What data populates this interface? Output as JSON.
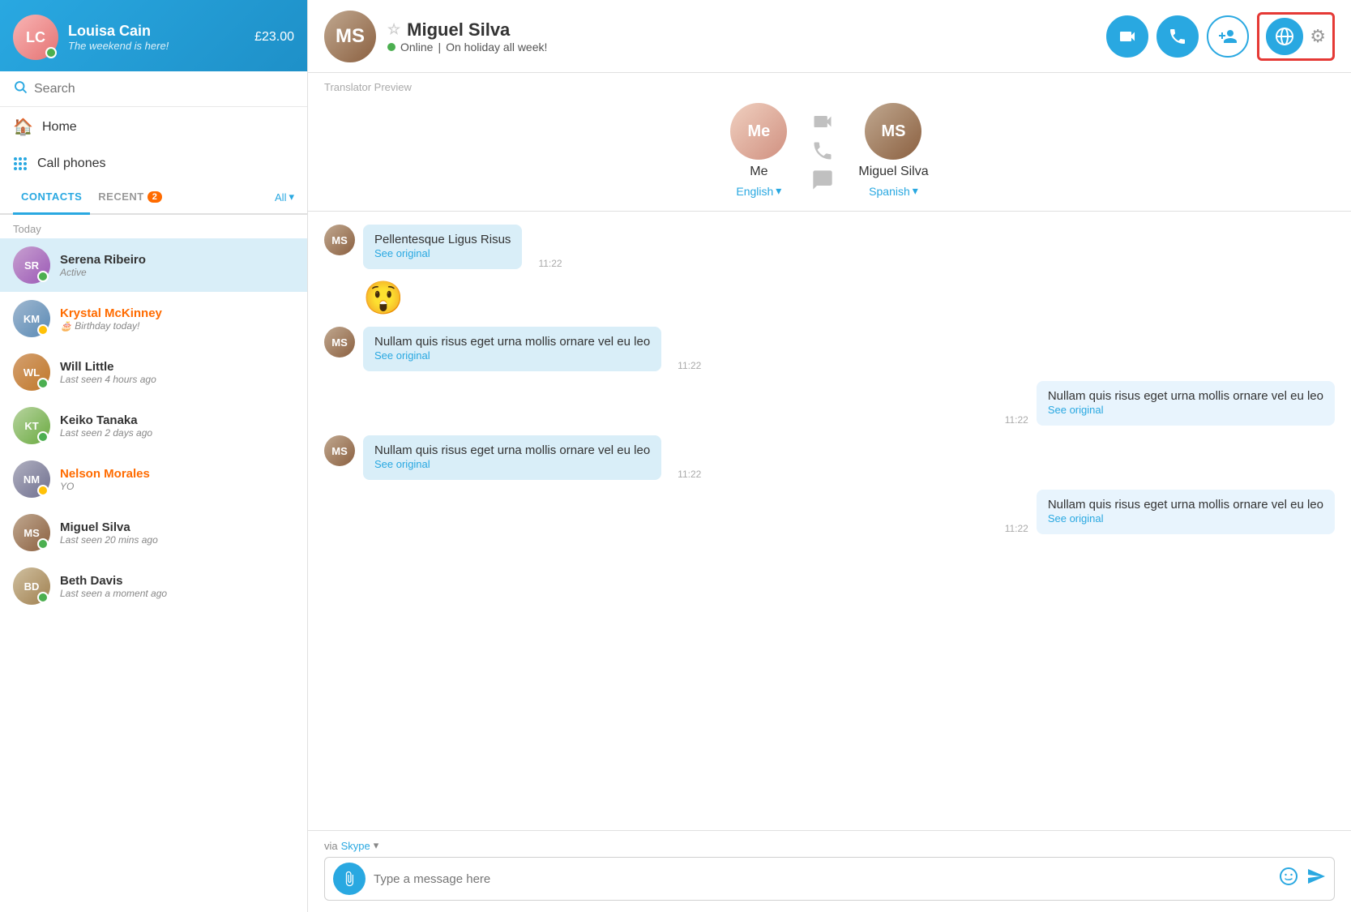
{
  "sidebar": {
    "user": {
      "name": "Louisa Cain",
      "status": "The weekend is here!",
      "credit": "£23.00",
      "initials": "LC"
    },
    "search": {
      "placeholder": "Search"
    },
    "nav": [
      {
        "id": "home",
        "label": "Home",
        "icon": "🏠"
      },
      {
        "id": "callphones",
        "label": "Call phones",
        "icon": "⠿"
      }
    ],
    "tabs": [
      {
        "id": "contacts",
        "label": "CONTACTS",
        "active": true,
        "badge": null
      },
      {
        "id": "recent",
        "label": "RECENT",
        "active": false,
        "badge": "2"
      }
    ],
    "all_label": "All",
    "section_today": "Today",
    "contacts": [
      {
        "id": "serena",
        "name": "Serena Ribeiro",
        "sub": "Active",
        "status": "online",
        "selected": true,
        "initials": "SR",
        "color": "av-serena",
        "nameColor": ""
      },
      {
        "id": "krystal",
        "name": "Krystal McKinney",
        "sub": "🎂 Birthday today!",
        "status": "away",
        "selected": false,
        "initials": "KM",
        "color": "av-krystal",
        "nameColor": "orange"
      },
      {
        "id": "will",
        "name": "Will Little",
        "sub": "Last seen 4 hours ago",
        "status": "online",
        "selected": false,
        "initials": "WL",
        "color": "av-will",
        "nameColor": ""
      },
      {
        "id": "keiko",
        "name": "Keiko Tanaka",
        "sub": "Last seen 2 days ago",
        "status": "online",
        "selected": false,
        "initials": "KT",
        "color": "av-keiko",
        "nameColor": ""
      },
      {
        "id": "nelson",
        "name": "Nelson Morales",
        "sub": "YO",
        "status": "away",
        "selected": false,
        "initials": "NM",
        "color": "av-nelson",
        "nameColor": "orange"
      },
      {
        "id": "miguel",
        "name": "Miguel Silva",
        "sub": "Last seen 20 mins ago",
        "status": "online",
        "selected": false,
        "initials": "MS",
        "color": "av-miguel",
        "nameColor": ""
      },
      {
        "id": "beth",
        "name": "Beth Davis",
        "sub": "Last seen a moment ago",
        "status": "online",
        "selected": false,
        "initials": "BD",
        "color": "av-beth",
        "nameColor": ""
      }
    ]
  },
  "chat": {
    "contact_name": "Miguel Silva",
    "contact_status": "Online",
    "contact_status_extra": "On holiday all week!",
    "contact_initials": "MS",
    "translator": {
      "label": "Translator Preview",
      "me_name": "Me",
      "me_lang": "English",
      "me_initials": "Me",
      "contact_name": "Miguel Silva",
      "contact_lang": "Spanish",
      "contact_initials": "MS",
      "divider_icon1": "📹",
      "divider_icon2": "📞",
      "divider_icon3": "💬"
    },
    "messages": [
      {
        "id": 1,
        "side": "left",
        "text": "Pellentesque Ligus Risus",
        "see_original": "See original",
        "time": "11:22",
        "initials": "MS"
      },
      {
        "id": 2,
        "side": "emoji",
        "emoji": "😲"
      },
      {
        "id": 3,
        "side": "left",
        "text": "Nullam quis risus eget urna mollis ornare vel eu leo",
        "see_original": "See original",
        "time": "11:22",
        "initials": "MS"
      },
      {
        "id": 4,
        "side": "right",
        "text": "Nullam quis risus eget urna mollis ornare vel eu leo",
        "see_original": "See original",
        "time": "11:22"
      },
      {
        "id": 5,
        "side": "left",
        "text": "Nullam quis risus eget urna mollis ornare vel eu leo",
        "see_original": "See original",
        "time": "11:22",
        "initials": "MS"
      },
      {
        "id": 6,
        "side": "right",
        "text": "Nullam quis risus eget urna mollis ornare vel eu leo",
        "see_original": "See original",
        "time": "11:22"
      }
    ],
    "via_label": "via",
    "via_service": "Skype",
    "input_placeholder": "Type a message here",
    "buttons": {
      "video": "📹",
      "call": "📞",
      "add": "👤+",
      "translator": "🌐",
      "settings": "⚙"
    }
  }
}
